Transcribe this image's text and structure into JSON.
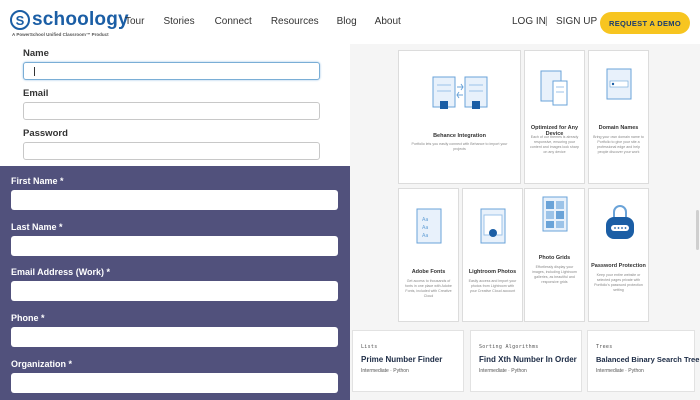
{
  "header": {
    "logo_mark": "S",
    "logo_text": "schoology",
    "logo_sub": "A PowerSchool Unified Classroom™ Product",
    "nav": [
      "Tour",
      "Stories",
      "Connect",
      "Resources",
      "Blog",
      "About"
    ],
    "login": "LOG IN",
    "separator": "|",
    "signup": "SIGN UP",
    "demo": "REQUEST A DEMO",
    "demo_color": "#f7c520",
    "brand_color": "#1b5ea5"
  },
  "top_form": {
    "fields": [
      {
        "label": "Name",
        "value": ""
      },
      {
        "label": "Email",
        "value": ""
      },
      {
        "label": "Password",
        "value": ""
      }
    ]
  },
  "purple_form": {
    "background": "#51517c",
    "fields": [
      {
        "label": "First Name *",
        "value": ""
      },
      {
        "label": "Last Name *",
        "value": ""
      },
      {
        "label": "Email Address (Work) *",
        "value": ""
      },
      {
        "label": "Phone *",
        "value": ""
      },
      {
        "label": "Organization *",
        "value": ""
      }
    ]
  },
  "features": [
    {
      "title": "Behance Integration",
      "desc": "Portfolio lets you easily connect with Behance to import your projects",
      "icon": "behance-sync-icon"
    },
    {
      "title": "Optimized for Any Device",
      "desc": "Each of our themes is already responsive, ensuring your content and images look sharp on any device",
      "icon": "devices-icon"
    },
    {
      "title": "Domain Names",
      "desc": "Bring your own domain name to Portfolio to give your site a professional edge and help people discover your work",
      "icon": "domain-icon"
    },
    {
      "title": "Adobe Fonts",
      "desc": "Get access to thousands of fonts in one place with Adobe Fonts, included with Creative Cloud",
      "icon": "fonts-icon"
    },
    {
      "title": "Lightroom Photos",
      "desc": "Easily access and import your photos from Lightroom with your Creative Cloud account",
      "icon": "lightroom-icon"
    },
    {
      "title": "Photo Grids",
      "desc": "Effortlessly display your images, including Lightroom galleries, as beautiful and responsive grids",
      "icon": "photo-grid-icon"
    },
    {
      "title": "Password Protection",
      "desc": "Keep your entire website or selected pages private with Portfolio's password protection setting",
      "icon": "password-lock-icon"
    }
  ],
  "bottom_cards": [
    {
      "category": "Lists",
      "title": "Prime Number Finder",
      "meta": "Intermediate · Python"
    },
    {
      "category": "Sorting Algorithms",
      "title": "Find Xth Number In Order",
      "meta": "Intermediate · Python"
    },
    {
      "category": "Trees",
      "title": "Balanced Binary Search Tree",
      "meta": "Intermediate · Python"
    }
  ]
}
